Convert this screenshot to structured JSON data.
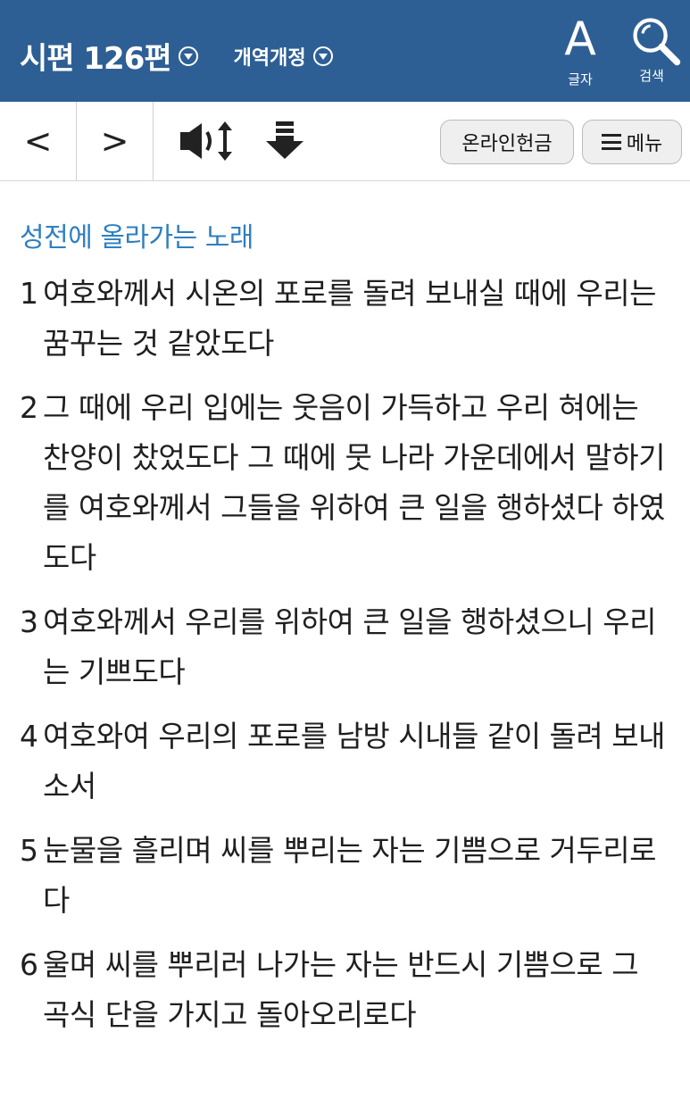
{
  "header": {
    "book_title": "시편 126편",
    "version": "개역개정",
    "font_caption": "글자",
    "font_glyph": "A",
    "search_caption": "검색"
  },
  "toolbar": {
    "prev": "<",
    "next": ">",
    "offering": "온라인헌금",
    "menu": "메뉴"
  },
  "content": {
    "heading": "성전에 올라가는 노래",
    "verses": [
      {
        "num": "1",
        "text": "여호와께서 시온의 포로를 돌려 보내실 때에 우리는 꿈꾸는 것 같았도다"
      },
      {
        "num": "2",
        "text": "그 때에 우리 입에는 웃음이 가득하고 우리 혀에는 찬양이 찼었도다 그 때에 뭇 나라 가운데에서 말하기를 여호와께서 그들을 위하여 큰 일을 행하셨다 하였도다"
      },
      {
        "num": "3",
        "text": "여호와께서 우리를 위하여 큰 일을 행하셨으니 우리는 기쁘도다"
      },
      {
        "num": "4",
        "text": "여호와여 우리의 포로를 남방 시내들 같이 돌려 보내소서"
      },
      {
        "num": "5",
        "text": "눈물을 흘리며 씨를 뿌리는 자는 기쁨으로 거두리로다"
      },
      {
        "num": "6",
        "text": "울며 씨를 뿌리러 나가는 자는 반드시 기쁨으로 그 곡식 단을 가지고 돌아오리로다"
      }
    ]
  }
}
